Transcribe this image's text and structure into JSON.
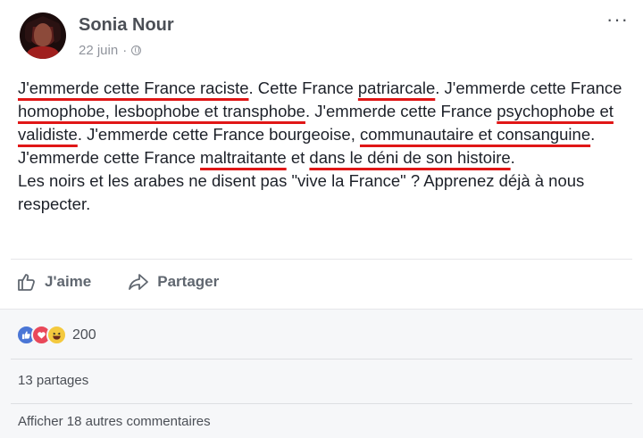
{
  "post": {
    "author": "Sonia Nour",
    "date": "22 juin",
    "separator": "·",
    "more_menu": "···",
    "paragraph1": [
      {
        "text": "J'emmerde cette France raciste",
        "underlined": true
      },
      {
        "text": ". Cette France ",
        "underlined": false
      },
      {
        "text": "patriarcale",
        "underlined": true
      },
      {
        "text": ". J'emmerde cette France ",
        "underlined": false
      },
      {
        "text": "homophobe, lesbophobe et transphobe",
        "underlined": true
      },
      {
        "text": ". J'emmerde cette France ",
        "underlined": false
      },
      {
        "text": "psychophobe et validiste",
        "underlined": true
      },
      {
        "text": ". J'emmerde cette France bourgeoise, ",
        "underlined": false
      },
      {
        "text": "communautaire et consanguine",
        "underlined": true
      },
      {
        "text": ". J'emmerde cette France ",
        "underlined": false
      },
      {
        "text": "maltraitante",
        "underlined": true
      },
      {
        "text": " et ",
        "underlined": false
      },
      {
        "text": "dans le déni de son histoire",
        "underlined": true
      },
      {
        "text": ".",
        "underlined": false
      }
    ],
    "paragraph2": "Les noirs et les arabes ne disent pas \"vive la France\" ? Apprenez déjà à nous respecter."
  },
  "actions": {
    "like_label": "J'aime",
    "share_label": "Partager"
  },
  "footer": {
    "reaction_count": "200",
    "shares": "13 partages",
    "more_comments": "Afficher 18 autres commentaires"
  },
  "colors": {
    "underline": "#e01616",
    "like_blue": "#4a76d6",
    "love_red": "#e9485a",
    "haha_yellow": "#f4c93e"
  },
  "icons": [
    "globe-icon",
    "more-options-icon",
    "like-thumb-icon",
    "share-arrow-icon",
    "reaction-like-icon",
    "reaction-love-icon",
    "reaction-haha-icon"
  ]
}
